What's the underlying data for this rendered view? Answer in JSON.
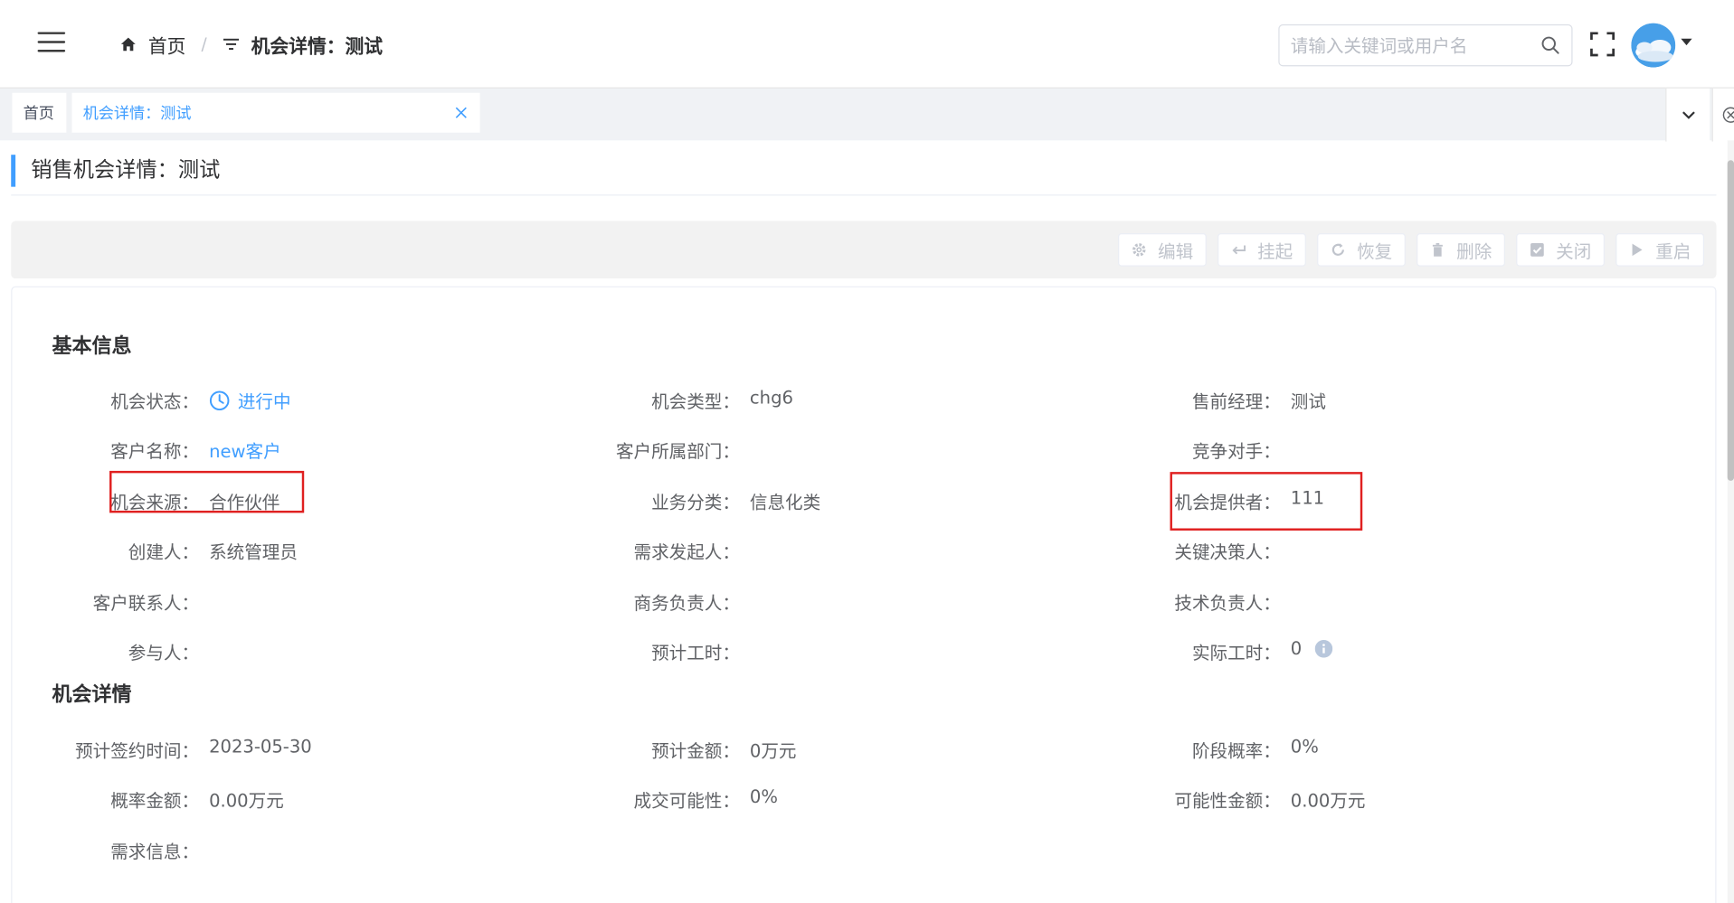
{
  "navbar": {
    "breadcrumb": {
      "home": "首页",
      "separator": "/",
      "current": "机会详情：测试"
    },
    "search": {
      "placeholder": "请输入关键词或用户名"
    }
  },
  "tags": {
    "home": "首页",
    "active": "机会详情：测试"
  },
  "page": {
    "title": "销售机会详情：测试"
  },
  "toolbar": {
    "edit": "编辑",
    "suspend": "挂起",
    "restore": "恢复",
    "delete": "删除",
    "close": "关闭",
    "restart": "重启"
  },
  "basic_info": {
    "title": "基本信息",
    "fields": [
      {
        "label": "机会状态：",
        "value": "进行中"
      },
      {
        "label": "机会类型：",
        "value": "chg6"
      },
      {
        "label": "售前经理：",
        "value": "测试"
      },
      {
        "label": "客户名称：",
        "value": "new客户"
      },
      {
        "label": "客户所属部门：",
        "value": ""
      },
      {
        "label": "竞争对手：",
        "value": ""
      },
      {
        "label": "机会来源：",
        "value": "合作伙伴"
      },
      {
        "label": "业务分类：",
        "value": "信息化类"
      },
      {
        "label": "机会提供者：",
        "value": "111"
      },
      {
        "label": "创建人：",
        "value": "系统管理员"
      },
      {
        "label": "需求发起人：",
        "value": ""
      },
      {
        "label": "关键决策人：",
        "value": ""
      },
      {
        "label": "客户联系人：",
        "value": ""
      },
      {
        "label": "商务负责人：",
        "value": ""
      },
      {
        "label": "技术负责人：",
        "value": ""
      },
      {
        "label": "参与人：",
        "value": ""
      },
      {
        "label": "预计工时：",
        "value": ""
      },
      {
        "label": "实际工时：",
        "value": "0"
      }
    ]
  },
  "opportunity_detail": {
    "title": "机会详情",
    "fields": [
      {
        "label": "预计签约时间：",
        "value": "2023-05-30"
      },
      {
        "label": "预计金额：",
        "value": "0万元"
      },
      {
        "label": "阶段概率：",
        "value": "0%"
      },
      {
        "label": "概率金额：",
        "value": "0.00万元"
      },
      {
        "label": "成交可能性：",
        "value": "0%"
      },
      {
        "label": "可能性金额：",
        "value": "0.00万元"
      },
      {
        "label": "需求信息：",
        "value": ""
      }
    ]
  },
  "colors": {
    "accent": "#409eff",
    "highlight": "#e02020",
    "disabled": "#c0c4cc"
  }
}
